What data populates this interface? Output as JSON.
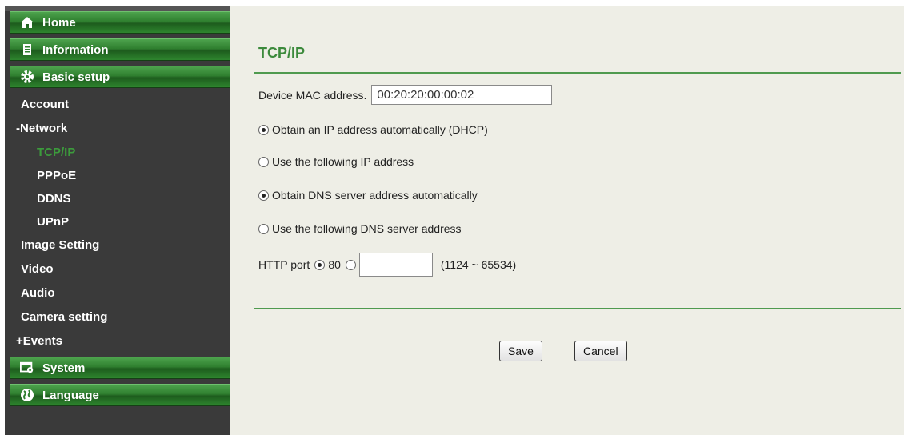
{
  "sidebar": {
    "home": {
      "label": "Home",
      "icon": "home-icon"
    },
    "information": {
      "label": "Information",
      "icon": "info-icon"
    },
    "basic_setup": {
      "label": "Basic setup",
      "icon": "gear-icon"
    },
    "basic_items": {
      "account": "Account",
      "network": "-Network",
      "tcpip": "TCP/IP",
      "pppoe": "PPPoE",
      "ddns": "DDNS",
      "upnp": "UPnP",
      "image_setting": "Image Setting",
      "video": "Video",
      "audio": "Audio",
      "camera_setting": "Camera setting",
      "events": "+Events"
    },
    "system": {
      "label": "System",
      "icon": "system-icon"
    },
    "language": {
      "label": "Language",
      "icon": "globe-icon"
    }
  },
  "main": {
    "title": "TCP/IP",
    "mac_label": "Device MAC address.",
    "mac_value": "00:20:20:00:00:02",
    "opt_dhcp": "Obtain an IP address automatically (DHCP)",
    "opt_static_ip": "Use the following IP address",
    "opt_dns_auto": "Obtain DNS server address automatically",
    "opt_dns_manual": "Use the following DNS server address",
    "http_port_label": "HTTP port",
    "http_port_default": "80",
    "http_port_custom_value": "",
    "http_port_range": "(1124 ~ 65534)",
    "save_label": "Save",
    "cancel_label": "Cancel"
  },
  "colors": {
    "sidebar_bg": "#3a3a3a",
    "nav_green": "#2f7f2f",
    "active_item": "#3c9b3c",
    "content_bg": "#eeeee6",
    "title_green": "#3c8a3c"
  }
}
